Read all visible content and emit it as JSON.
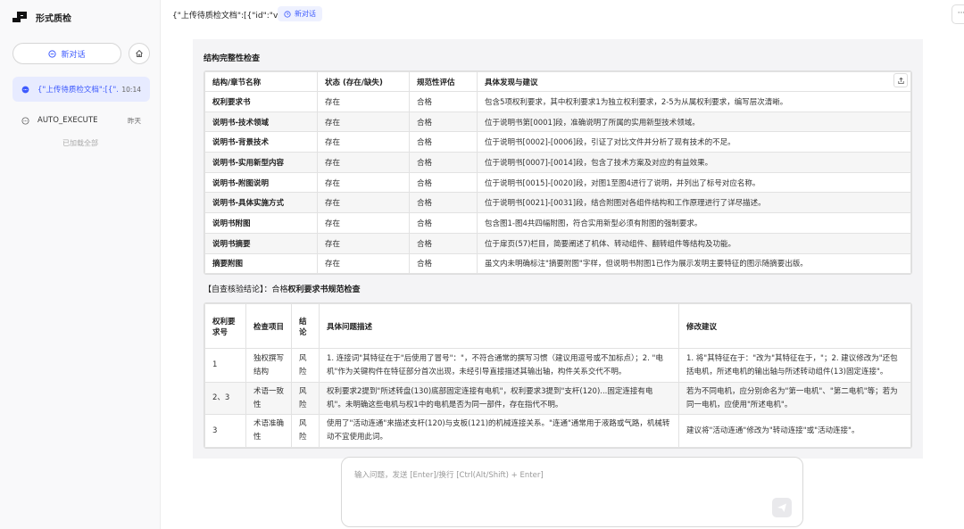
{
  "app": {
    "title": "形式质检"
  },
  "sidebar": {
    "new_chat": "新对话",
    "conversations": [
      {
        "title": "{\"上传待质检文档\":[{\"...",
        "time": "10:14",
        "active": true
      },
      {
        "title": "AUTO_EXECUTE",
        "time": "昨天",
        "active": false
      }
    ],
    "loaded_all": "已加载全部"
  },
  "header": {
    "title": "{\"上传待质检文档\":[{\"id\":\"v",
    "new_chat": "新对话",
    "more": "···"
  },
  "structure_check": {
    "title": "结构完整性检查",
    "headers": [
      "结构/章节名称",
      "状态 (存在/缺失)",
      "规范性评估",
      "具体发现与建议"
    ],
    "rows": [
      [
        "权利要求书",
        "存在",
        "合格",
        "包含5项权利要求，其中权利要求1为独立权利要求，2-5为从属权利要求，编写层次清晰。"
      ],
      [
        "说明书-技术领域",
        "存在",
        "合格",
        "位于说明书第[0001]段，准确说明了所属的实用新型技术领域。"
      ],
      [
        "说明书-背景技术",
        "存在",
        "合格",
        "位于说明书[0002]-[0006]段，引证了对比文件并分析了现有技术的不足。"
      ],
      [
        "说明书-实用新型内容",
        "存在",
        "合格",
        "位于说明书[0007]-[0014]段，包含了技术方案及对应的有益效果。"
      ],
      [
        "说明书-附图说明",
        "存在",
        "合格",
        "位于说明书[0015]-[0020]段，对图1至图4进行了说明，并列出了标号对应名称。"
      ],
      [
        "说明书-具体实施方式",
        "存在",
        "合格",
        "位于说明书[0021]-[0031]段，结合附图对各组件结构和工作原理进行了详尽描述。"
      ],
      [
        "说明书附图",
        "存在",
        "合格",
        "包含图1-图4共四幅附图，符合实用新型必须有附图的强制要求。"
      ],
      [
        "说明书摘要",
        "存在",
        "合格",
        "位于扉页(57)栏目，简要阐述了机体、转动组件、翻转组件等结构及功能。"
      ],
      [
        "摘要附图",
        "存在",
        "合格",
        "虽文内未明确标注\"摘要附图\"字样，但说明书附图1已作为展示发明主要特征的图示随摘要出版。"
      ]
    ]
  },
  "conclusion": {
    "prefix": "【自查核验结论】：合格",
    "next_title": "权利要求书规范检查"
  },
  "claims_check": {
    "headers": [
      "权利要求号",
      "检查项目",
      "结论",
      "具体问题描述",
      "修改建议"
    ],
    "rows": [
      [
        "1",
        "独权撰写结构",
        "风险",
        "1. 连接词\"其特征在于\"后使用了冒号\"：\"，不符合通常的撰写习惯（建议用逗号或不加标点）；2. \"电机\"作为关键构件在特征部分首次出现，未经引导直接描述其输出轴，构件关系交代不明。",
        "1. 将\"其特征在于：\"改为\"其特征在于，\"；2. 建议修改为\"还包括电机，所述电机的输出轴与所述转动组件(13)固定连接\"。"
      ],
      [
        "2、3",
        "术语一致性",
        "风险",
        "权利要求2提到\"所述转盘(130)底部固定连接有电机\"，权利要求3提到\"支杆(120)...固定连接有电机\"。未明确这些电机与权1中的电机是否为同一部件，存在指代不明。",
        "若为不同电机，应分别命名为\"第一电机\"、\"第二电机\"等；若为同一电机，应使用\"所述电机\"。"
      ],
      [
        "3",
        "术语准确性",
        "风险",
        "使用了\"活动连通\"来描述支杆(120)与支板(121)的机械连接关系。\"连通\"通常用于液路或气路，机械转动不宜使用此词。",
        "建议将\"活动连通\"修改为\"转动连接\"或\"活动连接\"。"
      ]
    ]
  },
  "input": {
    "placeholder": "输入问题，发送 [Enter]/换行 [Ctrl(Alt/Shift) + Enter]"
  },
  "colors": {
    "accent": "#3d5afe",
    "sidebar_bg": "#f9f9fa",
    "active_conv_bg": "#e7ebff"
  }
}
